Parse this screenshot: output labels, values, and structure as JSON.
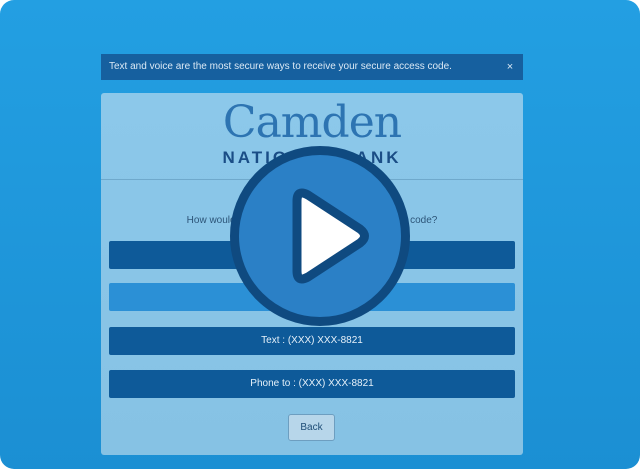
{
  "alert": {
    "message": "Text and voice are the most secure ways to receive your secure access code.",
    "close_glyph": "×"
  },
  "logo": {
    "name": "Camden",
    "subtitle": "NATIONAL BANK"
  },
  "prompt": {
    "question": "How would you like to receive your secure access code?"
  },
  "options": [
    {
      "label": ""
    },
    {
      "label": ""
    },
    {
      "label": "Text : (XXX) XXX-8821"
    },
    {
      "label": "Phone to : (XXX) XXX-8821"
    }
  ],
  "back_label": "Back",
  "overlay": {
    "icon": "play-icon"
  },
  "colors": {
    "background": "#1e97db",
    "option": "#0e5a99",
    "option_highlight": "#2b90d6",
    "play_ring": "#0f4a80",
    "logo": "#2d74b2"
  }
}
